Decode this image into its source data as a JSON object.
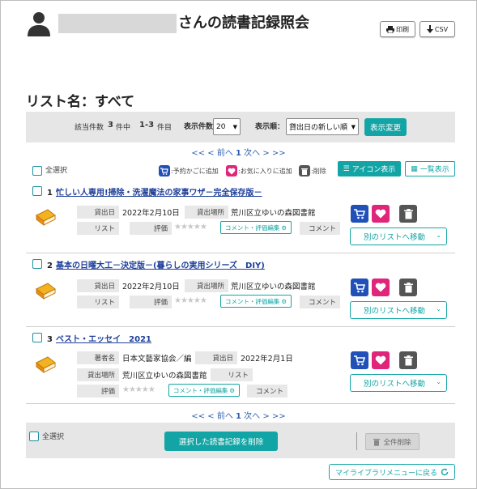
{
  "header": {
    "title": "さんの読書記録照会",
    "print_label": "印刷",
    "csv_label": "CSV"
  },
  "list_name": "リスト名：すべて",
  "controls": {
    "hits_label": "該当件数",
    "hits_count": "3",
    "hits_unit": "件中",
    "range": "1-3",
    "range_unit": "件目",
    "per_page_label": "表示件数",
    "per_page_value": "20",
    "sort_label": "表示順：",
    "sort_value": "貸出日の新しい順",
    "apply_label": "表示変更"
  },
  "pager": {
    "first": "<<",
    "prev": "< 前へ",
    "current": "1",
    "next": "次へ >",
    "last": ">>"
  },
  "select_all_label": "全選択",
  "legend": {
    "cart": ":予約かごに追加",
    "fav": ":お気に入りに追加",
    "del": ":削除"
  },
  "view": {
    "icon_label": "アイコン表示",
    "list_label": "一覧表示"
  },
  "field_labels": {
    "lend_date": "貸出日",
    "lend_place": "貸出場所",
    "list": "リスト",
    "rating": "評価",
    "comment": "コメント",
    "author": "著者名"
  },
  "comment_edit_label": "コメント・評価編集",
  "stars": "★★★★★",
  "move_label": "別のリストへ移動",
  "items": [
    {
      "num": "1",
      "title": "忙しい人専用!掃除・洗濯魔法の家事ワザ－完全保存版－",
      "lend_date": "2022年2月10日",
      "lend_place": "荒川区立ゆいの森図書館"
    },
    {
      "num": "2",
      "title": "基本の日曜大工－決定版－(暮らしの実用シリーズ　DIY)",
      "lend_date": "2022年2月10日",
      "lend_place": "荒川区立ゆいの森図書館"
    },
    {
      "num": "3",
      "title": "ベスト・エッセイ　2021",
      "author": "日本文藝家協会／編",
      "lend_date": "2022年2月1日",
      "lend_place": "荒川区立ゆいの森図書館"
    }
  ],
  "bottom": {
    "delete_selected_label": "選択した読書記録を削除",
    "delete_all_label": "全件削除",
    "back_label": "マイライブラリメニューに戻る"
  },
  "colors": {
    "teal": "#13a5a5",
    "cart_blue": "#2150b8",
    "fav_pink": "#e0267a",
    "link_blue": "#1e3f9a"
  }
}
